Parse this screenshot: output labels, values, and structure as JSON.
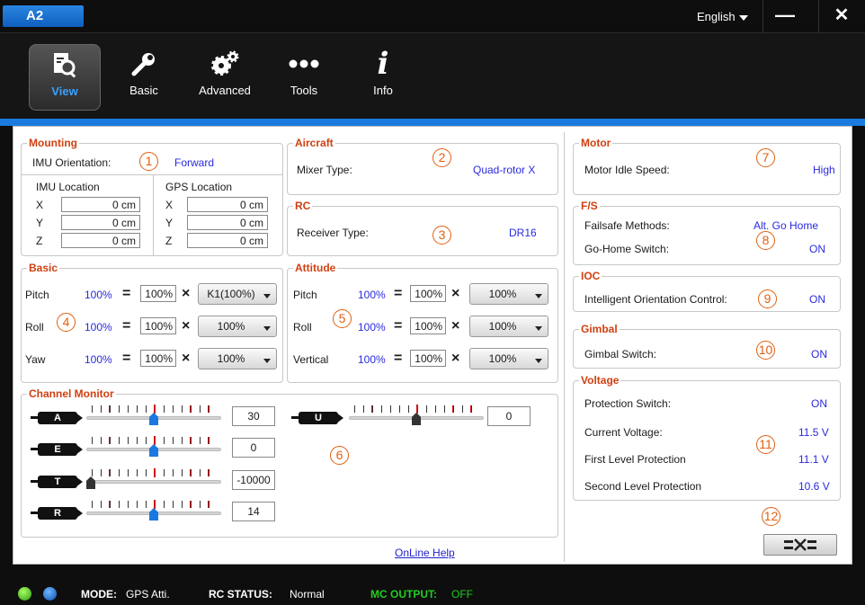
{
  "app": {
    "title": "A2",
    "language": "English",
    "minimize": "—",
    "close": "✕"
  },
  "toolbar": [
    {
      "label": "View",
      "icon": "view-icon"
    },
    {
      "label": "Basic",
      "icon": "wrench-icon"
    },
    {
      "label": "Advanced",
      "icon": "gears-icon"
    },
    {
      "label": "Tools",
      "icon": "dots-icon"
    },
    {
      "label": "Info",
      "icon": "info-icon"
    }
  ],
  "mounting": {
    "title": "Mounting",
    "imu_orientation_label": "IMU Orientation:",
    "imu_orientation_value": "Forward",
    "imu_location_label": "IMU Location",
    "gps_location_label": "GPS Location",
    "axes": [
      "X",
      "Y",
      "Z"
    ],
    "imu_values": [
      "0 cm",
      "0 cm",
      "0 cm"
    ],
    "gps_values": [
      "0 cm",
      "0 cm",
      "0 cm"
    ]
  },
  "aircraft": {
    "title": "Aircraft",
    "mixer_label": "Mixer Type:",
    "mixer_value": "Quad-rotor X"
  },
  "rc": {
    "title": "RC",
    "receiver_label": "Receiver Type:",
    "receiver_value": "DR16"
  },
  "basic": {
    "title": "Basic",
    "rows": [
      {
        "label": "Pitch",
        "gain": "100%",
        "base": "100%",
        "select": "K1(100%)"
      },
      {
        "label": "Roll",
        "gain": "100%",
        "base": "100%",
        "select": "100%"
      },
      {
        "label": "Yaw",
        "gain": "100%",
        "base": "100%",
        "select": "100%"
      }
    ]
  },
  "attitude": {
    "title": "Attitude",
    "rows": [
      {
        "label": "Pitch",
        "gain": "100%",
        "base": "100%",
        "select": "100%"
      },
      {
        "label": "Roll",
        "gain": "100%",
        "base": "100%",
        "select": "100%"
      },
      {
        "label": "Vertical",
        "gain": "100%",
        "base": "100%",
        "select": "100%"
      }
    ]
  },
  "symbols": {
    "eq": "=",
    "mul": "×"
  },
  "channel_monitor": {
    "title": "Channel Monitor",
    "channels": [
      {
        "name": "A",
        "value": "30",
        "position": 0.5
      },
      {
        "name": "E",
        "value": "0",
        "position": 0.5
      },
      {
        "name": "T",
        "value": "-10000",
        "position": 0.0
      },
      {
        "name": "R",
        "value": "14",
        "position": 0.5
      },
      {
        "name": "U",
        "value": "0",
        "position": 0.5
      }
    ]
  },
  "online_help": "OnLine Help",
  "motor": {
    "title": "Motor",
    "idle_label": "Motor Idle Speed:",
    "idle_value": "High"
  },
  "fs": {
    "title": "F/S",
    "methods_label": "Failsafe Methods:",
    "methods_value": "Alt. Go Home",
    "switch_label": "Go-Home Switch:",
    "switch_value": "ON"
  },
  "ioc": {
    "title": "IOC",
    "label": "Intelligent Orientation Control:",
    "value": "ON"
  },
  "gimbal": {
    "title": "Gimbal",
    "label": "Gimbal Switch:",
    "value": "ON"
  },
  "voltage": {
    "title": "Voltage",
    "rows": [
      {
        "label": "Protection Switch:",
        "value": "ON"
      },
      {
        "label": "Current Voltage:",
        "value": "11.5 V"
      },
      {
        "label": "First Level Protection",
        "value": "11.1 V"
      },
      {
        "label": "Second Level Protection",
        "value": "10.6 V"
      }
    ]
  },
  "markers": [
    "1",
    "2",
    "3",
    "4",
    "5",
    "6",
    "7",
    "8",
    "9",
    "10",
    "11",
    "12"
  ],
  "status": {
    "mode_label": "MODE:",
    "mode_value": "GPS Atti.",
    "rc_label": "RC STATUS:",
    "rc_value": "Normal",
    "mc_label": "MC OUTPUT:",
    "mc_value": "OFF"
  },
  "colors": {
    "accent": "#1a7ae0",
    "value_blue": "#2a2adf",
    "group_title": "#d04010",
    "marker": "#e06010",
    "mc_output": "#22cc22"
  }
}
